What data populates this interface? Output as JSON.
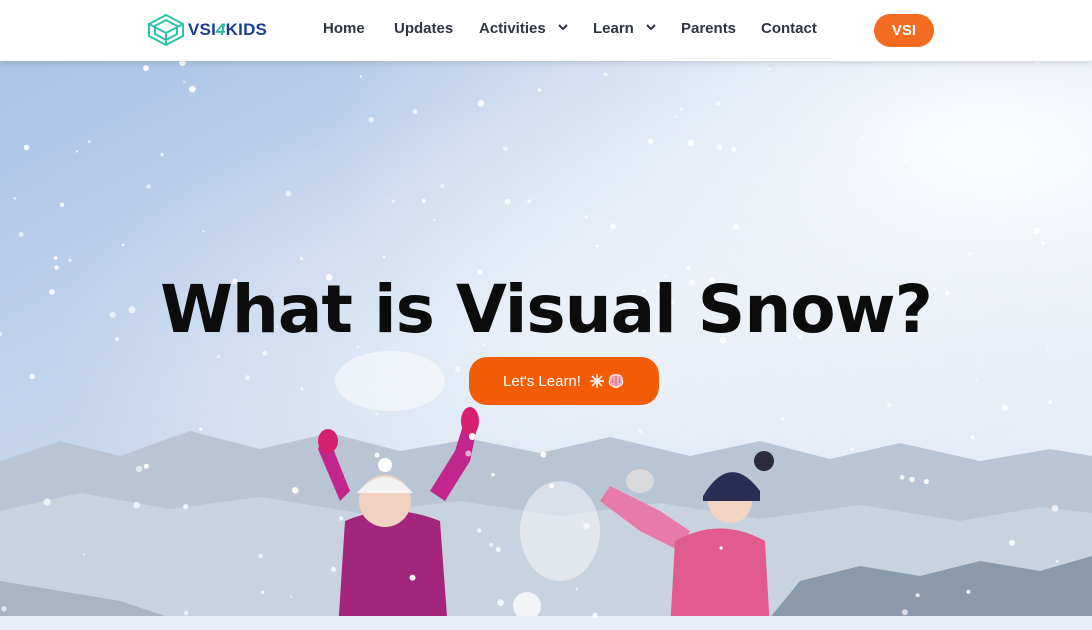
{
  "brand": {
    "logo_part1": "VSI",
    "logo_part2": "4",
    "logo_part3": "KIDS",
    "colors": {
      "primary": "#1b3f8f",
      "teal": "#22b8a4",
      "accent": "#f26b20"
    }
  },
  "nav": {
    "items": [
      {
        "label": "Home",
        "has_dropdown": false
      },
      {
        "label": "Updates",
        "has_dropdown": false
      },
      {
        "label": "Activities",
        "has_dropdown": true
      },
      {
        "label": "Learn",
        "has_dropdown": true
      },
      {
        "label": "Parents",
        "has_dropdown": false
      },
      {
        "label": "Contact",
        "has_dropdown": false
      }
    ],
    "cta_label": "VSI"
  },
  "hero": {
    "title": "What is Visual Snow?",
    "button_label": "Let's Learn!",
    "button_icons": [
      "snowflake-icon",
      "brain-icon"
    ]
  }
}
